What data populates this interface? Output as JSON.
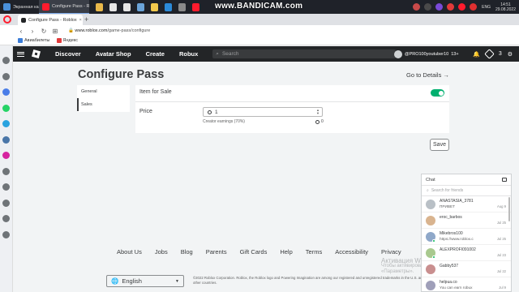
{
  "taskbar": {
    "apps": [
      {
        "label": "Экранная камера",
        "color": "#4a90d9"
      },
      {
        "label": "Configure Pass - Roblox",
        "color": "#ff1b2d"
      }
    ],
    "pinned_icons": [
      {
        "name": "folder-icon",
        "color": "#e8b84a"
      },
      {
        "name": "document-icon",
        "color": "#e6e6e6"
      },
      {
        "name": "document-icon",
        "color": "#e6e6e6"
      },
      {
        "name": "image-icon",
        "color": "#6aa3d8"
      },
      {
        "name": "yandex-browser-icon",
        "color": "#f2c94c"
      },
      {
        "name": "edge-icon",
        "color": "#2b8ad8"
      },
      {
        "name": "settings-icon",
        "color": "#8a8a8a"
      },
      {
        "name": "opera-icon",
        "color": "#ff1b2d"
      }
    ],
    "recorder_text": "www.BANDICAM.com",
    "tray_icons": [
      {
        "name": "app-icon",
        "color": "#c94a4a"
      },
      {
        "name": "app-icon",
        "color": "#4a4a4a"
      },
      {
        "name": "app-icon",
        "color": "#7a4ad8"
      },
      {
        "name": "yandex-icon",
        "color": "#e23a3a"
      },
      {
        "name": "opera-icon",
        "color": "#ff1b2d"
      },
      {
        "name": "record-icon",
        "color": "#e03030"
      }
    ],
    "lang": "ENG",
    "time": "14:51",
    "date": "29.08.2022"
  },
  "browser": {
    "tab_title": "Configure Pass - Roblox",
    "url_host": "www.roblox.com",
    "url_path": "/game-pass/configure",
    "bookmarks": [
      {
        "label": "Авиабилеты",
        "color": "#3b7dd8"
      },
      {
        "label": "Яндекс",
        "color": "#e23a3a"
      }
    ]
  },
  "sidebar_icons": [
    {
      "name": "home-icon",
      "color": "#6f7478"
    },
    {
      "name": "star-icon",
      "color": "#6f7478"
    },
    {
      "name": "messenger-icon",
      "color": "#4a7de8"
    },
    {
      "name": "whatsapp-icon",
      "color": "#25d366"
    },
    {
      "name": "telegram-icon",
      "color": "#2aa3df"
    },
    {
      "name": "vk-icon",
      "color": "#4a76a8"
    },
    {
      "name": "instagram-icon",
      "color": "#d6249f"
    },
    {
      "name": "history-icon",
      "color": "#6f7478"
    },
    {
      "name": "play-icon",
      "color": "#6f7478"
    },
    {
      "name": "clock-icon",
      "color": "#6f7478"
    },
    {
      "name": "settings-icon",
      "color": "#6f7478"
    },
    {
      "name": "heart-icon",
      "color": "#6f7478"
    }
  ],
  "header": {
    "nav": [
      "Discover",
      "Avatar Shop",
      "Create",
      "Robux"
    ],
    "search_placeholder": "Search",
    "username": "@PRO100youtuber10",
    "age_tag": "13+",
    "robux_count": "3"
  },
  "page": {
    "title": "Configure Pass",
    "goto_details": "Go to Details →",
    "tabs": [
      "General",
      "Sales"
    ],
    "item_for_sale_label": "Item for Sale",
    "item_for_sale_on": true,
    "price_label": "Price",
    "price_value": "1",
    "earnings_label": "Creator earnings (70%)",
    "earnings_value": "0",
    "save_label": "Save"
  },
  "footer": {
    "links": [
      "About Us",
      "Jobs",
      "Blog",
      "Parents",
      "Gift Cards",
      "Help",
      "Terms",
      "Accessibility",
      "Privacy"
    ],
    "language": "English",
    "copyright": "©2022 Roblox Corporation. Roblox, the Roblox logo and Powering Imagination are among our registered and unregistered trademarks in the U.S. and other countries.",
    "activation_title": "Активация Windows",
    "activation_text": "Чтобы активировать Windows, перейдите в раздел «Параметры»."
  },
  "chat": {
    "title": "Chat",
    "search_placeholder": "Search for friends",
    "conversations": [
      {
        "name": "ANASTASIA_3781",
        "message": "ПРИВЕТ",
        "date": "Aug 9",
        "online": false,
        "avatar": "#b9c0c6"
      },
      {
        "name": "eroc_barbos",
        "message": "",
        "date": "Jul 25",
        "online": false,
        "avatar": "#d9b48f"
      },
      {
        "name": "Mikebros100",
        "message": "https://www.roblox.c",
        "date": "Jul 25",
        "online": true,
        "avatar": "#8fa8c9"
      },
      {
        "name": "ALEXPROFI091002",
        "message": "",
        "date": "Jul 23",
        "online": true,
        "avatar": "#a9c98f"
      },
      {
        "name": "Gabby537",
        "message": "",
        "date": "Jul 22",
        "online": false,
        "avatar": "#c98f8f"
      },
      {
        "name": "helpua.co",
        "message": "You can earn robux",
        "date": "Jul 9",
        "online": false,
        "avatar": "#9f9fb9"
      }
    ]
  }
}
